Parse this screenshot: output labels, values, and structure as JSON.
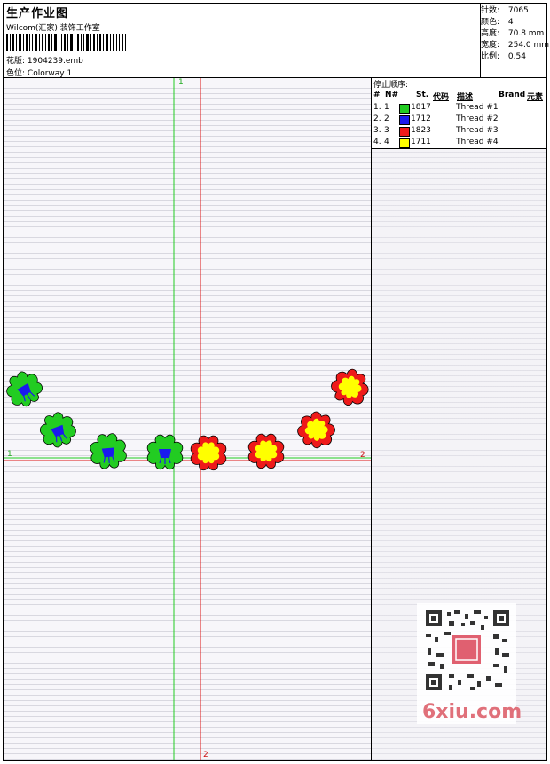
{
  "header": {
    "title": "生产作业图",
    "subtitle": "Wilcom(汇家) 装饰工作室",
    "pattern_label": "花版:",
    "pattern_value": "1904239.emb",
    "colorway_label": "色位:",
    "colorway_value": "Colorway 1"
  },
  "stats": [
    {
      "label": "针数:",
      "value": "7065"
    },
    {
      "label": "颜色:",
      "value": "4"
    },
    {
      "label": "高度:",
      "value": "70.8 mm"
    },
    {
      "label": "宽度:",
      "value": "254.0 mm"
    },
    {
      "label": "比例:",
      "value": "0.54"
    }
  ],
  "stop_sequence": {
    "title": "停止顺序:",
    "columns": [
      "#",
      "N#",
      "St.",
      "代码",
      "描述",
      "Brand",
      "元素"
    ],
    "rows": [
      {
        "num": "1.",
        "n": "1",
        "code": "1817",
        "desc": "Thread #1",
        "color": "#22cc22"
      },
      {
        "num": "2.",
        "n": "2",
        "code": "1712",
        "desc": "Thread #2",
        "color": "#1a1aee"
      },
      {
        "num": "3.",
        "n": "3",
        "code": "1823",
        "desc": "Thread #3",
        "color": "#ee1a1a"
      },
      {
        "num": "4.",
        "n": "4",
        "code": "1711",
        "desc": "Thread #4",
        "color": "#ffff00"
      }
    ]
  },
  "axes": {
    "green_top": "1",
    "red_bottom": "2",
    "left_mark": "1",
    "right_mark": "2"
  },
  "watermark": "6xiu.com"
}
